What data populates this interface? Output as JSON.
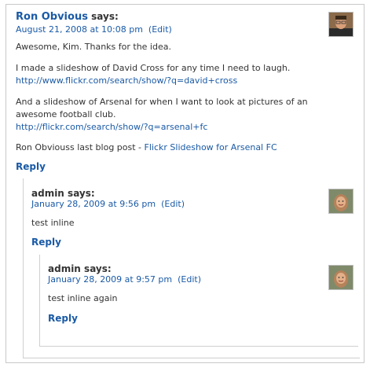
{
  "comment1": {
    "author": "Ron Obvious",
    "says": "says:",
    "date": "August 21, 2008 at 10:08 pm",
    "edit": "(Edit)",
    "p1": "Awesome, Kim. Thanks for the idea.",
    "p2_text": "I made a slideshow of David Cross for any time I need to laugh.",
    "p2_link": "http://www.flickr.com/search/show/?q=david+cross",
    "p3_text1": "And a slideshow of Arsenal for when I want to look at pictures of an",
    "p3_text2": "awesome football club.",
    "p3_link": "http://flickr.com/search/show/?q=arsenal+fc",
    "last_post_label": "Ron Obviouss last blog post - ",
    "last_post_link": "Flickr Slideshow for Arsenal FC",
    "reply": "Reply"
  },
  "comment2": {
    "author": "admin",
    "says": "says:",
    "date": "January 28, 2009 at 9:56 pm",
    "edit": "(Edit)",
    "body": "test inline",
    "reply": "Reply"
  },
  "comment3": {
    "author": "admin",
    "says": "says:",
    "date": "January 28, 2009 at 9:57 pm",
    "edit": "(Edit)",
    "body": "test inline again",
    "reply": "Reply"
  },
  "colors": {
    "link": "#1a5aa6",
    "text": "#333333",
    "border": "#c9c9c9"
  },
  "icons": {
    "avatar1": "user-avatar-photo",
    "avatar2": "user-avatar-photo",
    "avatar3": "user-avatar-photo"
  }
}
